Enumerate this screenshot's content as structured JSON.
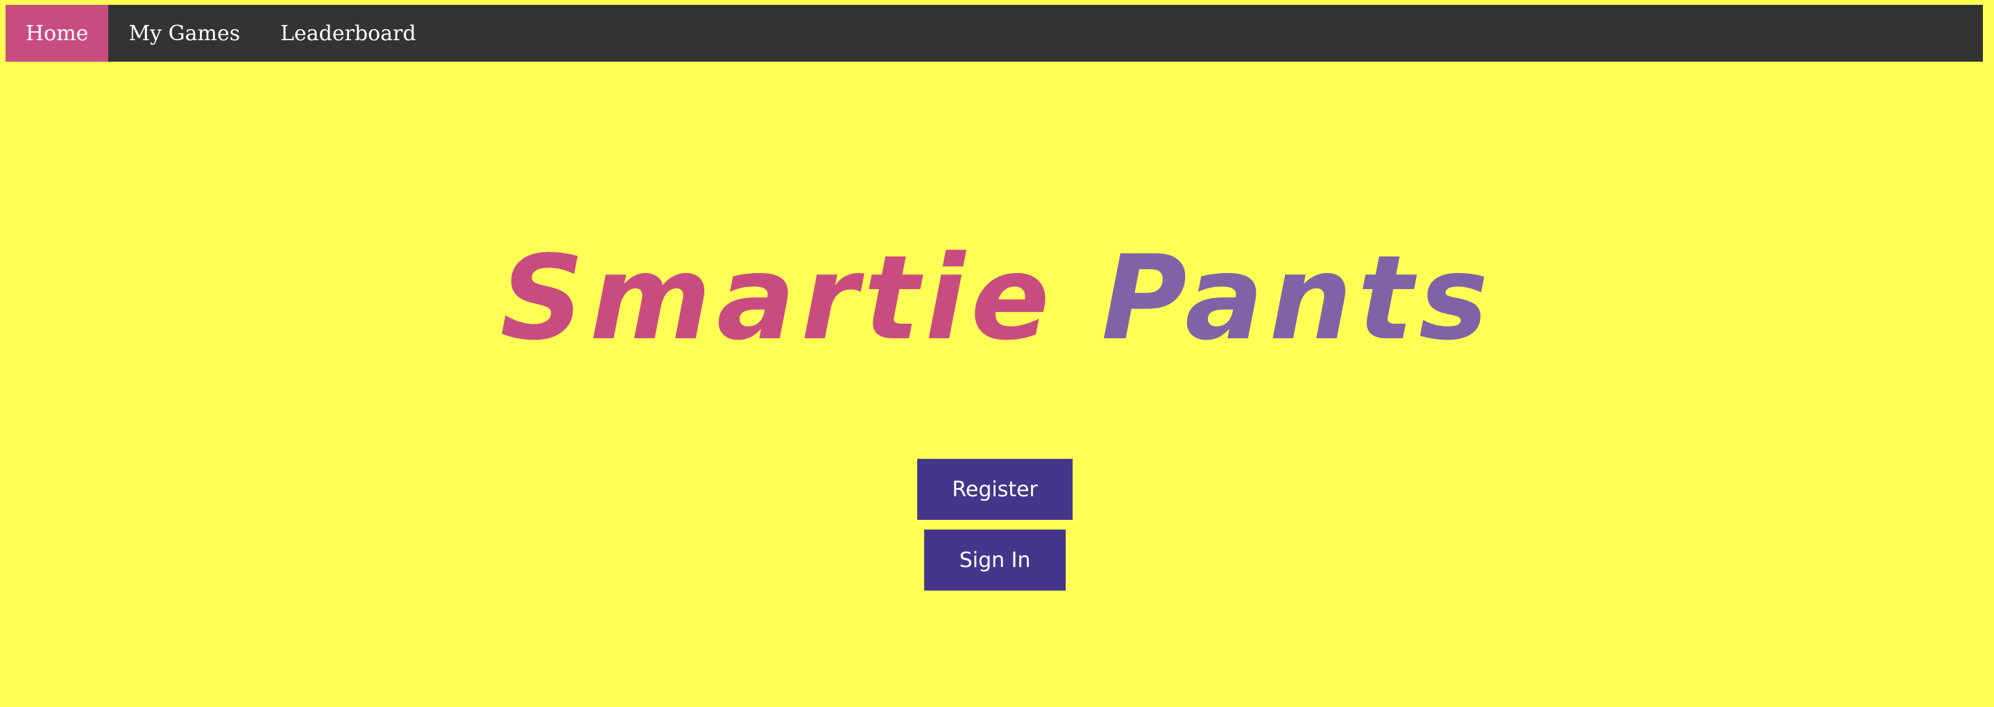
{
  "nav": {
    "items": [
      {
        "label": "Home",
        "active": true
      },
      {
        "label": "My Games",
        "active": false
      },
      {
        "label": "Leaderboard",
        "active": false
      }
    ]
  },
  "hero": {
    "title_part1": "Smartie",
    "title_part2": "Pants"
  },
  "actions": {
    "register_label": "Register",
    "signin_label": "Sign In"
  },
  "colors": {
    "background": "#ffff55",
    "navbar": "#333333",
    "nav_active": "#c94c80",
    "title_primary": "#c94c80",
    "title_secondary": "#7f63a6",
    "button": "#43368b"
  }
}
